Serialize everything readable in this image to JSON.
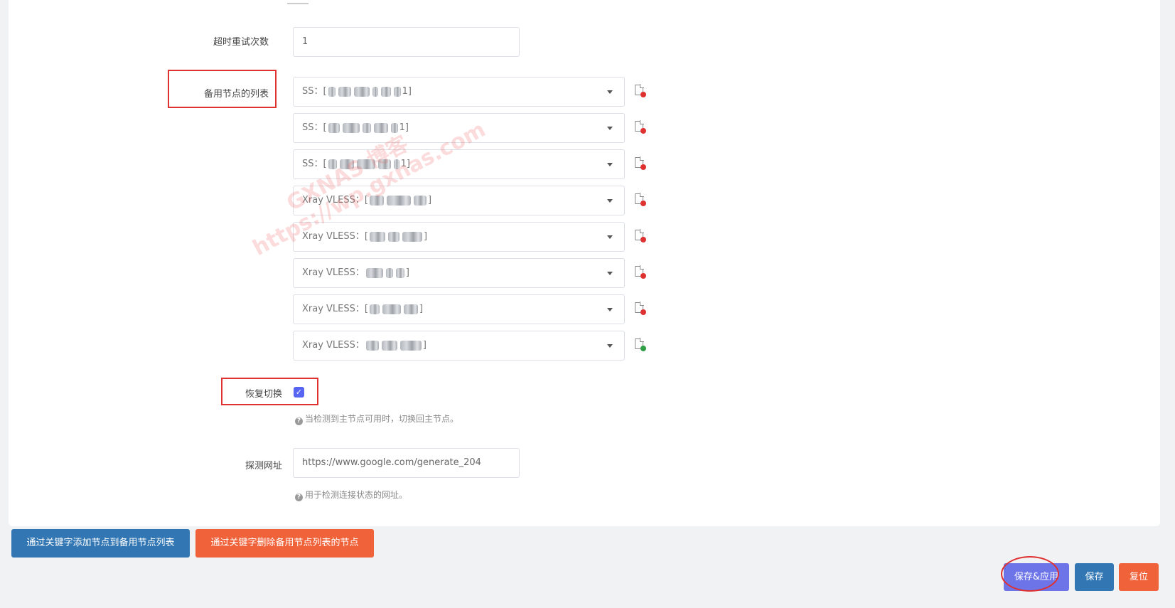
{
  "timeout_retry": {
    "label": "超时重试次数",
    "value": "1"
  },
  "backup_nodes": {
    "label": "备用节点的列表",
    "items": [
      {
        "prefix": "SS：[",
        "suffix": "1]",
        "status": "red"
      },
      {
        "prefix": "SS：[",
        "suffix": "1]",
        "status": "red"
      },
      {
        "prefix": "SS：[",
        "suffix": "1]",
        "status": "red"
      },
      {
        "prefix": "Xray VLESS：[",
        "suffix": "]",
        "status": "red"
      },
      {
        "prefix": "Xray VLESS：[",
        "suffix": "]",
        "status": "red"
      },
      {
        "prefix": "Xray VLESS：",
        "suffix": "]",
        "status": "red"
      },
      {
        "prefix": "Xray VLESS：[",
        "suffix": "]",
        "status": "red"
      },
      {
        "prefix": "Xray VLESS：",
        "suffix": "]",
        "status": "green"
      }
    ]
  },
  "restore_switch": {
    "label": "恢复切换",
    "checked": true,
    "help": "当检测到主节点可用时，切换回主节点。"
  },
  "probe_url": {
    "label": "探测网址",
    "value": "https://www.google.com/generate_204",
    "help": "用于检测连接状态的网址。"
  },
  "keyword_buttons": {
    "add": "通过关键字添加节点到备用节点列表",
    "remove": "通过关键字删除备用节点列表的节点"
  },
  "footer_buttons": {
    "save_apply": "保存&应用",
    "save": "保存",
    "reset": "复位"
  },
  "watermark": {
    "line1": "GXNAS 博客",
    "line2": "https://wp.gxnas.com"
  },
  "colors": {
    "status_red": "#e03131",
    "status_green": "#2f9e44",
    "btn_blue": "#3277b3",
    "btn_orange": "#f0623a",
    "btn_indigo": "#6c74e8",
    "annotation_red": "#e03131"
  }
}
